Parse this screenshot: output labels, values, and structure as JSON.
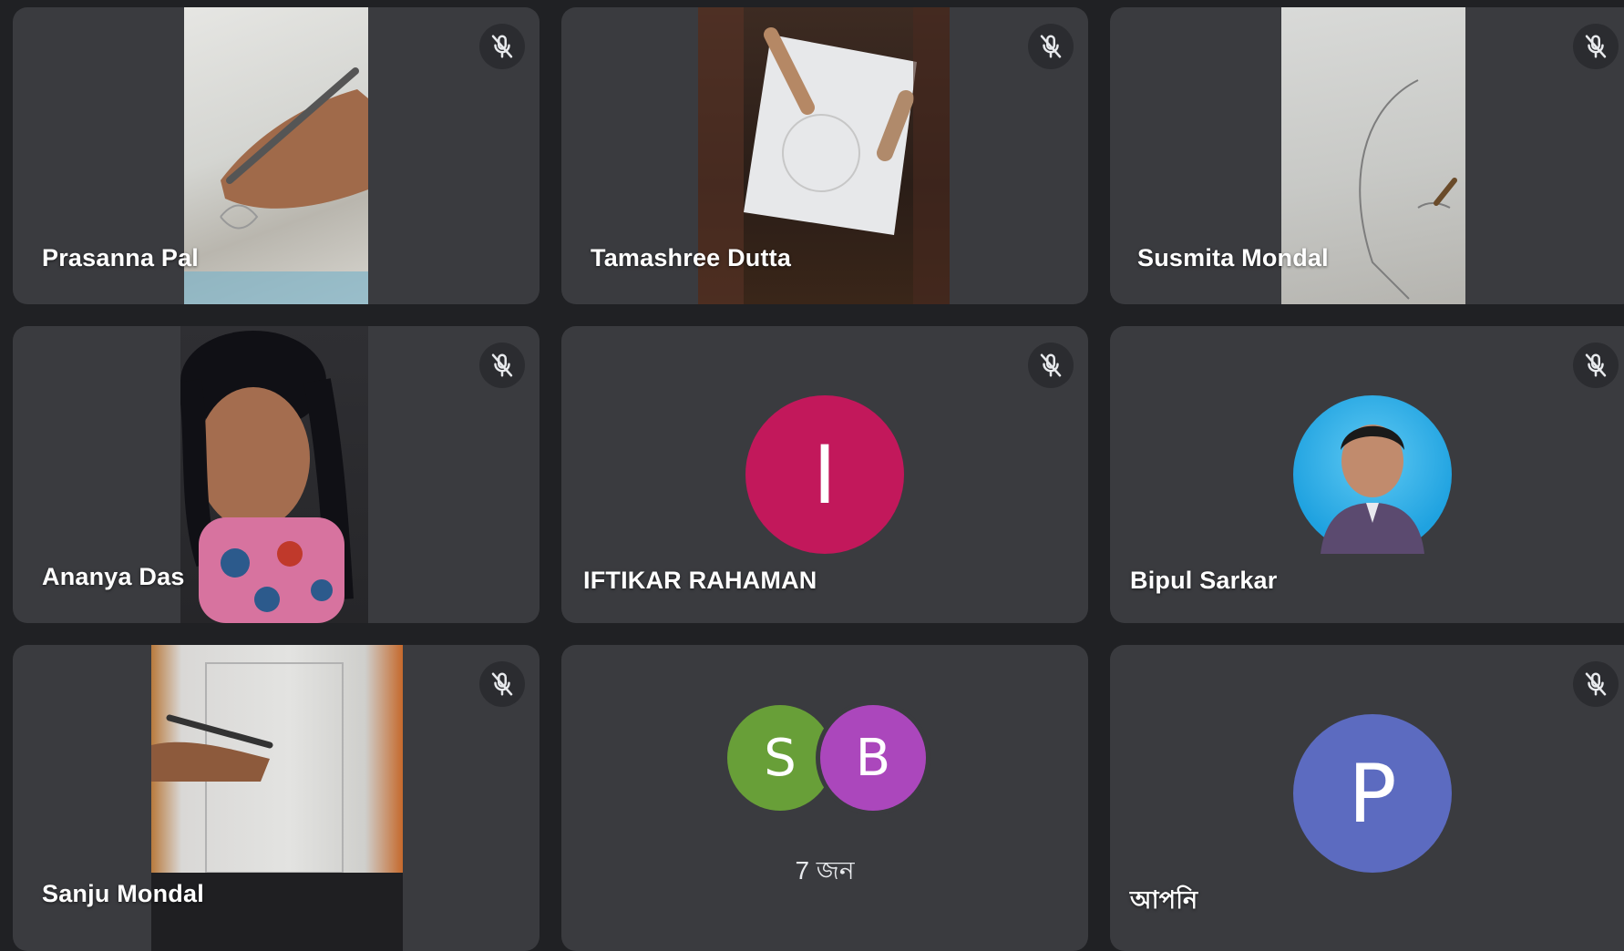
{
  "participants": [
    {
      "name": "Prasanna Pal"
    },
    {
      "name": "Tamashree Dutta"
    },
    {
      "name": "Susmita Mondal"
    },
    {
      "name": "Ananya Das"
    },
    {
      "name": "IFTIKAR RAHAMAN",
      "initial": "I",
      "avatar_color": "#c2185b"
    },
    {
      "name": "Bipul Sarkar"
    },
    {
      "name": "Sanju Mondal"
    },
    {
      "name": "আপনি",
      "initial": "P",
      "avatar_color": "#5c6bc0"
    }
  ],
  "others_tile": {
    "initials": [
      {
        "letter": "S",
        "color": "#689f38"
      },
      {
        "letter": "B",
        "color": "#ab47bc"
      }
    ],
    "count_label": "7 জন"
  },
  "icons": {
    "mute": "mic-off-icon"
  },
  "colors": {
    "background": "#202124",
    "tile": "#3a3b3f"
  }
}
